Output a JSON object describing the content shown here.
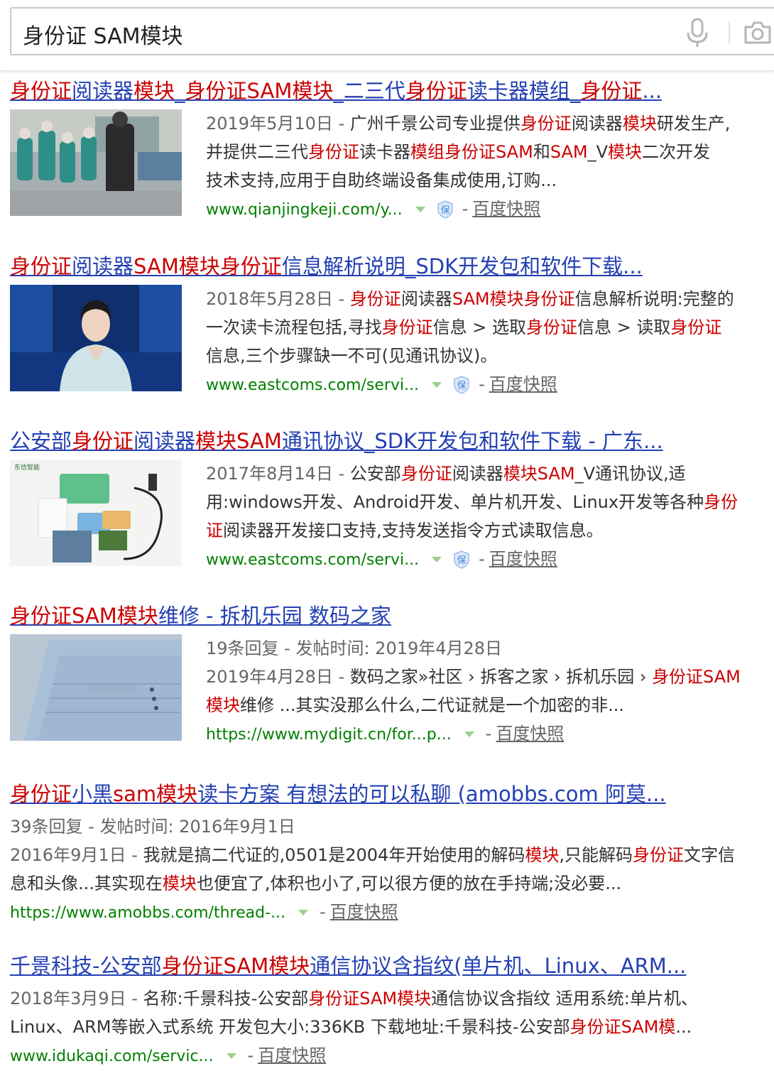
{
  "search": {
    "query": "身份证 SAM模块"
  },
  "results": [
    {
      "title": [
        {
          "t": "身份证",
          "hl": true
        },
        {
          "t": "阅读器",
          "hl": false
        },
        {
          "t": "模块",
          "hl": true
        },
        {
          "t": "_",
          "hl": false
        },
        {
          "t": "身份证SAM模块",
          "hl": true
        },
        {
          "t": "_二三代",
          "hl": false
        },
        {
          "t": "身份证",
          "hl": true
        },
        {
          "t": "读卡器模组_",
          "hl": false
        },
        {
          "t": "身份证",
          "hl": true
        },
        {
          "t": "...",
          "hl": false
        }
      ],
      "thumb": "students-crossing-street-photo",
      "lines": [
        [
          {
            "t": "2019年5月10日 - ",
            "meta": true
          },
          {
            "t": "广州千景公司专业提供"
          },
          {
            "t": "身份证",
            "hl": true
          },
          {
            "t": "阅读器"
          },
          {
            "t": "模块",
            "hl": true
          },
          {
            "t": "研发生产,"
          }
        ],
        [
          {
            "t": "并提供二三代"
          },
          {
            "t": "身份证",
            "hl": true
          },
          {
            "t": "读卡器"
          },
          {
            "t": "模组身份证SAM",
            "hl": true
          },
          {
            "t": "和"
          },
          {
            "t": "SAM",
            "hl": true
          },
          {
            "t": "_V"
          },
          {
            "t": "模块",
            "hl": true
          },
          {
            "t": "二次开发"
          }
        ],
        [
          {
            "t": "技术支持,应用于自助终端设备集成使用,订购..."
          }
        ]
      ],
      "url": "www.qianjingkeji.com/y...",
      "has_bao": true,
      "snapshot": "百度快照"
    },
    {
      "title": [
        {
          "t": "身份证",
          "hl": true
        },
        {
          "t": "阅读器",
          "hl": false
        },
        {
          "t": "SAM模块身份证",
          "hl": true
        },
        {
          "t": "信息解析说明_SDK开发包和软件下载...",
          "hl": false
        }
      ],
      "thumb": "news-anchor-photo",
      "lines": [
        [
          {
            "t": "2018年5月28日 - ",
            "meta": true
          },
          {
            "t": "身份证",
            "hl": true
          },
          {
            "t": "阅读器"
          },
          {
            "t": "SAM模块身份证",
            "hl": true
          },
          {
            "t": "信息解析说明:完整的"
          }
        ],
        [
          {
            "t": "一次读卡流程包括,寻找"
          },
          {
            "t": "身份证",
            "hl": true
          },
          {
            "t": "信息 > 选取"
          },
          {
            "t": "身份证",
            "hl": true
          },
          {
            "t": "信息 > 读取"
          },
          {
            "t": "身份证",
            "hl": true
          }
        ],
        [
          {
            "t": "信息,三个步骤缺一不可(见通讯协议)。"
          }
        ]
      ],
      "url": "www.eastcoms.com/servi...",
      "has_bao": true,
      "snapshot": "百度快照"
    },
    {
      "title": [
        {
          "t": "公安部",
          "hl": false
        },
        {
          "t": "身份证",
          "hl": true
        },
        {
          "t": "阅读器",
          "hl": false
        },
        {
          "t": "模块SAM",
          "hl": true
        },
        {
          "t": "通讯协议_SDK开发包和软件下载 - 广东...",
          "hl": false
        }
      ],
      "thumb": "card-reader-module-photo",
      "lines": [
        [
          {
            "t": "2017年8月14日 - ",
            "meta": true
          },
          {
            "t": "公安部"
          },
          {
            "t": "身份证",
            "hl": true
          },
          {
            "t": "阅读器"
          },
          {
            "t": "模块SAM",
            "hl": true
          },
          {
            "t": "_V通讯协议,适"
          }
        ],
        [
          {
            "t": "用:windows开发、Android开发、单片机开发、Linux开发等各种"
          },
          {
            "t": "身份",
            "hl": true
          }
        ],
        [
          {
            "t": "证",
            "hl": true
          },
          {
            "t": "阅读器开发接口支持,支持发送指令方式读取信息。"
          }
        ]
      ],
      "url": "www.eastcoms.com/servi...",
      "has_bao": true,
      "snapshot": "百度快照"
    },
    {
      "title": [
        {
          "t": "身份证SAM模块",
          "hl": true
        },
        {
          "t": "维修 - 拆机乐园 数码之家",
          "hl": false
        }
      ],
      "thumb": "blue-device-photo",
      "lines": [
        [
          {
            "t": "19条回复 - 发帖时间: 2019年4月28日",
            "meta": true
          }
        ],
        [
          {
            "t": "2019年4月28日 - ",
            "meta": true
          },
          {
            "t": "数码之家»社区 › 拆客之家 › 拆机乐园 › "
          },
          {
            "t": "身份证SAM",
            "hl": true
          }
        ],
        [
          {
            "t": "模块",
            "hl": true
          },
          {
            "t": "维修 ...其实没那么什么,二代证就是一个加密的非..."
          }
        ]
      ],
      "url": "https://www.mydigit.cn/for...p...",
      "has_bao": false,
      "snapshot": "百度快照"
    },
    {
      "title": [
        {
          "t": "身份证",
          "hl": true
        },
        {
          "t": "小黑",
          "hl": false
        },
        {
          "t": "sam模块",
          "hl": true
        },
        {
          "t": "读卡方案 有想法的可以私聊 (amobbs.com 阿莫...",
          "hl": false
        }
      ],
      "thumb": "",
      "lines": [
        [
          {
            "t": "39条回复 - 发帖时间: 2016年9月1日",
            "meta": true
          }
        ],
        [
          {
            "t": "2016年9月1日 - ",
            "meta": true
          },
          {
            "t": "我就是搞二代证的,0501是2004年开始使用的解码"
          },
          {
            "t": "模块",
            "hl": true
          },
          {
            "t": ",只能解码"
          },
          {
            "t": "身份证",
            "hl": true
          },
          {
            "t": "文字信"
          }
        ],
        [
          {
            "t": "息和头像...其实现在"
          },
          {
            "t": "模块",
            "hl": true
          },
          {
            "t": "也便宜了,体积也小了,可以很方便的放在手持端;没必要..."
          }
        ]
      ],
      "url": "https://www.amobbs.com/thread-...",
      "has_bao": false,
      "snapshot": "百度快照"
    },
    {
      "title": [
        {
          "t": "千景科技-公安部",
          "hl": false
        },
        {
          "t": "身份证SAM模块",
          "hl": true
        },
        {
          "t": "通信协议含指纹(单片机、Linux、ARM...",
          "hl": false
        }
      ],
      "thumb": "",
      "lines": [
        [
          {
            "t": "2018年3月9日 - ",
            "meta": true
          },
          {
            "t": "名称:千景科技-公安部"
          },
          {
            "t": "身份证SAM模块",
            "hl": true
          },
          {
            "t": "通信协议含指纹 适用系统:单片机、"
          }
        ],
        [
          {
            "t": "Linux、ARM等嵌入式系统 开发包大小:336KB 下载地址:千景科技-公安部"
          },
          {
            "t": "身份证SAM模",
            "hl": true
          },
          {
            "t": "..."
          }
        ]
      ],
      "url": "www.idukaqi.com/servic...",
      "has_bao": false,
      "snapshot": "百度快照"
    }
  ]
}
